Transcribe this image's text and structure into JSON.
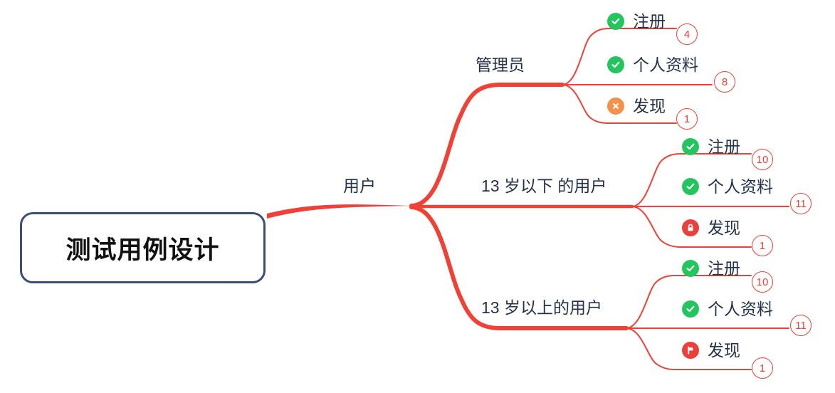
{
  "colors": {
    "branch": "#ef4135",
    "root_border": "#3a4f73",
    "text": "#24314a",
    "root_text": "#111111",
    "icon_success": "#22c55e",
    "icon_warning": "#f59149",
    "icon_danger": "#e8403a",
    "badge_border": "#ef4135",
    "background": "#ffffff"
  },
  "root": {
    "label": "测试用例设计"
  },
  "level1": {
    "label": "用户"
  },
  "groups": [
    {
      "label": "管理员",
      "leaves": [
        {
          "icon": "check-circle-icon",
          "icon_style": "success",
          "label": "注册",
          "badge": "4"
        },
        {
          "icon": "check-circle-icon",
          "icon_style": "success",
          "label": "个人资料",
          "badge": "8"
        },
        {
          "icon": "cross-circle-icon",
          "icon_style": "warning",
          "label": "发现",
          "badge": "1"
        }
      ]
    },
    {
      "label": "13 岁以下 的用户",
      "leaves": [
        {
          "icon": "check-circle-icon",
          "icon_style": "success",
          "label": "注册",
          "badge": "10"
        },
        {
          "icon": "check-circle-icon",
          "icon_style": "success",
          "label": "个人资料",
          "badge": "11"
        },
        {
          "icon": "lock-circle-icon",
          "icon_style": "danger",
          "label": "发现",
          "badge": "1"
        }
      ]
    },
    {
      "label": "13 岁以上的用户",
      "leaves": [
        {
          "icon": "check-circle-icon",
          "icon_style": "success",
          "label": "注册",
          "badge": "10"
        },
        {
          "icon": "check-circle-icon",
          "icon_style": "success",
          "label": "个人资料",
          "badge": "11"
        },
        {
          "icon": "flag-circle-icon",
          "icon_style": "danger",
          "label": "发现",
          "badge": "1"
        }
      ]
    }
  ]
}
